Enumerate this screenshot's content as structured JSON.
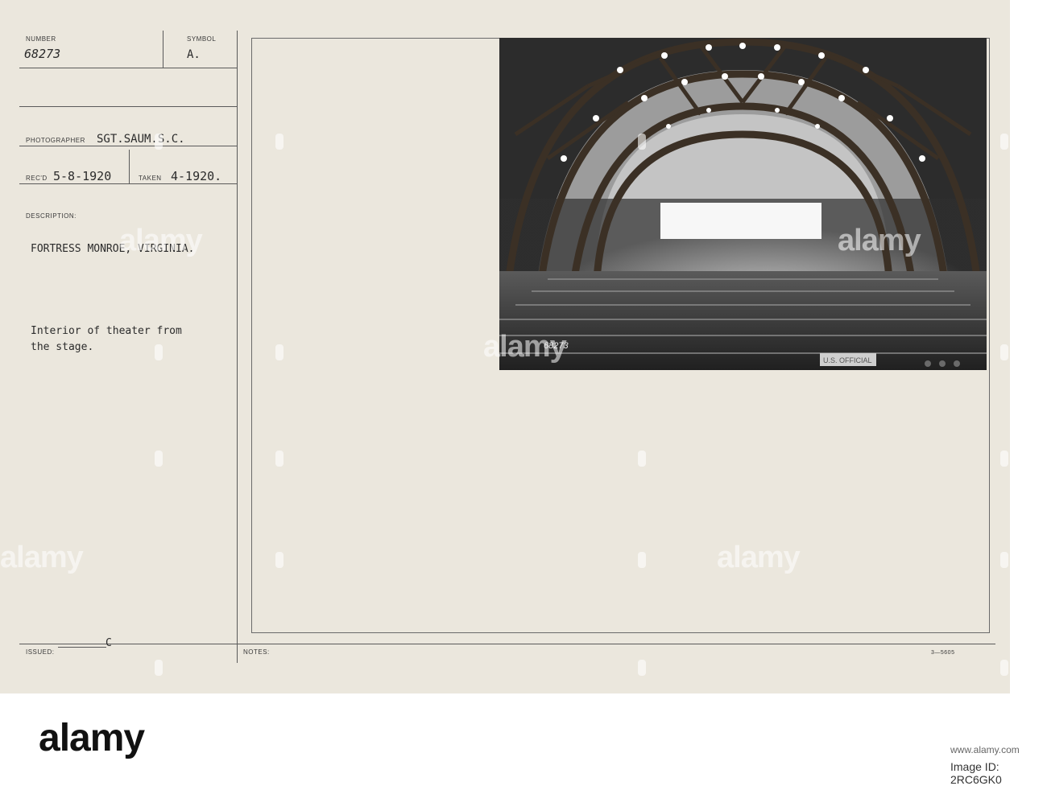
{
  "card": {
    "number_label": "NUMBER",
    "number_value": "68273",
    "symbol_label": "SYMBOL",
    "symbol_value": "A.",
    "photographer_label": "PHOTOGRAPHER",
    "photographer_value": "SGT.SAUM.S.C.",
    "recd_label": "REC'D",
    "recd_value": "5-8-1920",
    "taken_label": "TAKEN",
    "taken_value": "4-1920.",
    "description_label": "DESCRIPTION:",
    "location": "FORTRESS MONROE, VIRGINIA.",
    "caption_line1": "Interior of theater from",
    "caption_line2": "the stage.",
    "issued_label": "ISSUED:",
    "issued_value": "C",
    "notes_label": "NOTES:",
    "form_number": "3—5605"
  },
  "photo": {
    "negative_number": "68273",
    "official_stamp": "U.S. OFFICIAL"
  },
  "watermark": {
    "text": "alamy"
  },
  "footer": {
    "logo": "alamy",
    "image_id": "Image ID: 2RC6GK0",
    "website": "www.alamy.com"
  }
}
